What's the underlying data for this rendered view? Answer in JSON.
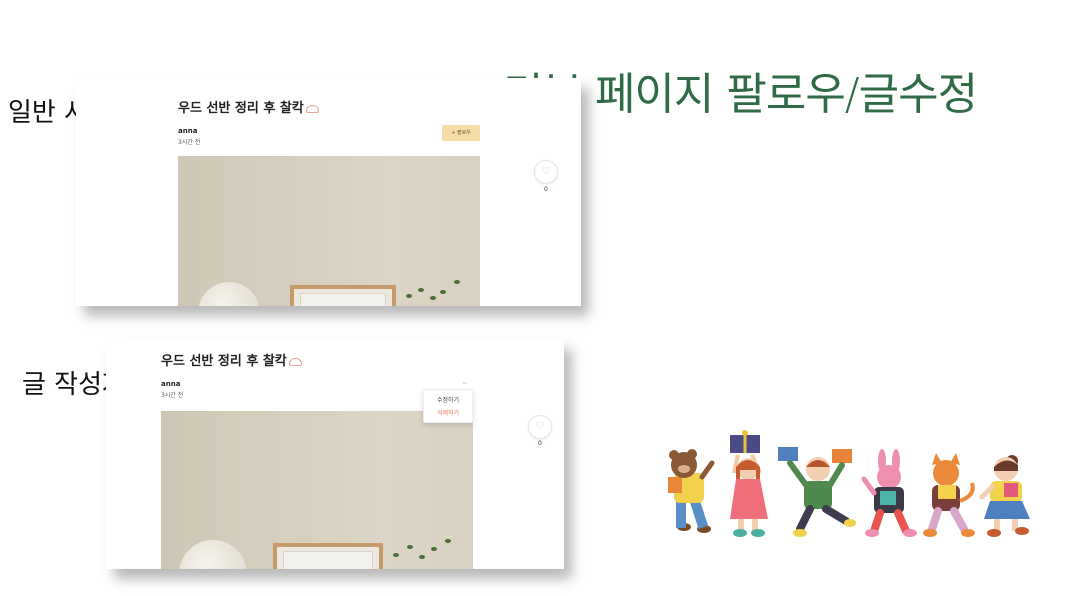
{
  "slide": {
    "title": "리뷰 페이지 팔로우/글수정",
    "label_normal_user": "일반 사용자",
    "label_author": "글 작성자"
  },
  "post": {
    "title": "우드 선반 정리 후 찰칵",
    "author": "anna",
    "time": "3시간 전",
    "follow_label": "+ 팔로우",
    "like_count": "0"
  },
  "author_menu": {
    "more": "···",
    "edit": "수정하기",
    "delete": "삭제하기"
  },
  "colors": {
    "title_green": "#2f6b46",
    "follow_bg": "#f7dca8",
    "delete_red": "#e86a5a",
    "heart": "#f2b483"
  }
}
